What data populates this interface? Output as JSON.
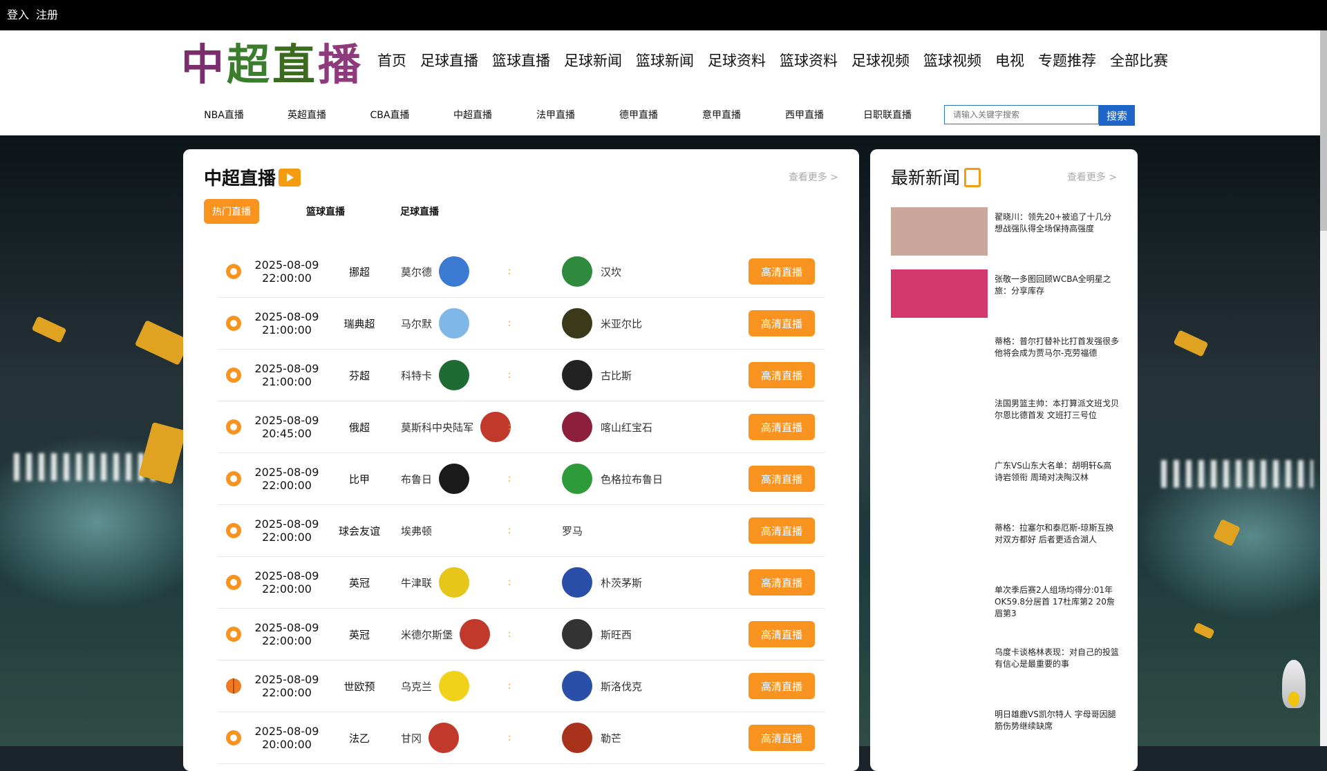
{
  "topbar": {
    "login": "登入",
    "register": "注册"
  },
  "logo": {
    "text": [
      "中",
      "超",
      "直",
      "播"
    ]
  },
  "mainnav": [
    "首页",
    "足球直播",
    "篮球直播",
    "足球新闻",
    "篮球新闻",
    "足球资料",
    "篮球资料",
    "足球视频",
    "篮球视频",
    "电视",
    "专题推荐",
    "全部比赛"
  ],
  "subnav": [
    "NBA直播",
    "英超直播",
    "CBA直播",
    "中超直播",
    "法甲直播",
    "德甲直播",
    "意甲直播",
    "西甲直播",
    "日职联直播"
  ],
  "search": {
    "placeholder": "请输入关键字搜索",
    "button": "搜索"
  },
  "live": {
    "title": "中超直播",
    "more": "查看更多 >",
    "tabs": [
      "热门直播",
      "篮球直播",
      "足球直播"
    ],
    "button_label": "高清直播",
    "matches": [
      {
        "sport": "soccer",
        "date": "2025-08-09",
        "time": "22:00:00",
        "league": "挪超",
        "home": "莫尔德",
        "away": "汉坎",
        "home_color": "#3b7bd4",
        "away_color": "#2e8b3e"
      },
      {
        "sport": "soccer",
        "date": "2025-08-09",
        "time": "21:00:00",
        "league": "瑞典超",
        "home": "马尔默",
        "away": "米亚尔比",
        "home_color": "#7fb7e6",
        "away_color": "#3a3a1a"
      },
      {
        "sport": "soccer",
        "date": "2025-08-09",
        "time": "21:00:00",
        "league": "芬超",
        "home": "科特卡",
        "away": "古比斯",
        "home_color": "#1e6b34",
        "away_color": "#222222"
      },
      {
        "sport": "soccer",
        "date": "2025-08-09",
        "time": "20:45:00",
        "league": "俄超",
        "home": "莫斯科中央陆军",
        "away": "喀山红宝石",
        "home_color": "#c0392b",
        "away_color": "#8e1f3c"
      },
      {
        "sport": "soccer",
        "date": "2025-08-09",
        "time": "22:00:00",
        "league": "比甲",
        "home": "布鲁日",
        "away": "色格拉布鲁日",
        "home_color": "#1a1a1a",
        "away_color": "#2e9b3a"
      },
      {
        "sport": "soccer",
        "date": "2025-08-09",
        "time": "22:00:00",
        "league": "球会友谊",
        "home": "埃弗顿",
        "away": "罗马",
        "home_color": "",
        "away_color": ""
      },
      {
        "sport": "soccer",
        "date": "2025-08-09",
        "time": "22:00:00",
        "league": "英冠",
        "home": "牛津联",
        "away": "朴茨茅斯",
        "home_color": "#e6c619",
        "away_color": "#2a4fa8"
      },
      {
        "sport": "soccer",
        "date": "2025-08-09",
        "time": "22:00:00",
        "league": "英冠",
        "home": "米德尔斯堡",
        "away": "斯旺西",
        "home_color": "#c0392b",
        "away_color": "#333333"
      },
      {
        "sport": "basket",
        "date": "2025-08-09",
        "time": "22:00:00",
        "league": "世欧预",
        "home": "乌克兰",
        "away": "斯洛伐克",
        "home_color": "#f1d21a",
        "away_color": "#2a4fa8"
      },
      {
        "sport": "soccer",
        "date": "2025-08-09",
        "time": "20:00:00",
        "league": "法乙",
        "home": "甘冈",
        "away": "勒芒",
        "home_color": "#c0392b",
        "away_color": "#a8321c"
      }
    ]
  },
  "news": {
    "title": "最新新闻",
    "more": "查看更多 >",
    "items": [
      {
        "text": "翟晓川：领先20+被追了十几分 想战强队得全场保持高强度",
        "thumb": "#c9a79a"
      },
      {
        "text": "张敬一多图回顾WCBA全明星之旅：分享库存",
        "thumb": "#d2386b"
      },
      {
        "text": "蒂格：普尔打替补比打首发强很多 他将会成为贾马尔-克劳福德",
        "thumb": ""
      },
      {
        "text": "法国男篮主帅：本打算派文班戈贝尔恩比德首发 文班打三号位",
        "thumb": ""
      },
      {
        "text": "广东VS山东大名单：胡明轩&高诗岩领衔 周琦对决陶汉林",
        "thumb": ""
      },
      {
        "text": "蒂格：拉塞尔和泰厄斯-琼斯互换对双方都好 后者更适合湖人",
        "thumb": ""
      },
      {
        "text": "单次季后赛2人组场均得分:01年OK59.8分居首 17杜库第2 20詹眉第3",
        "thumb": ""
      },
      {
        "text": "乌度卡谈格林表现：对自己的投篮有信心是最重要的事",
        "thumb": ""
      },
      {
        "text": "明日雄鹿VS凯尔特人 字母哥因腿筋伤势继续缺席",
        "thumb": ""
      }
    ]
  },
  "colors": {
    "accent": "#f7931e",
    "search_blue": "#1f66c9"
  }
}
